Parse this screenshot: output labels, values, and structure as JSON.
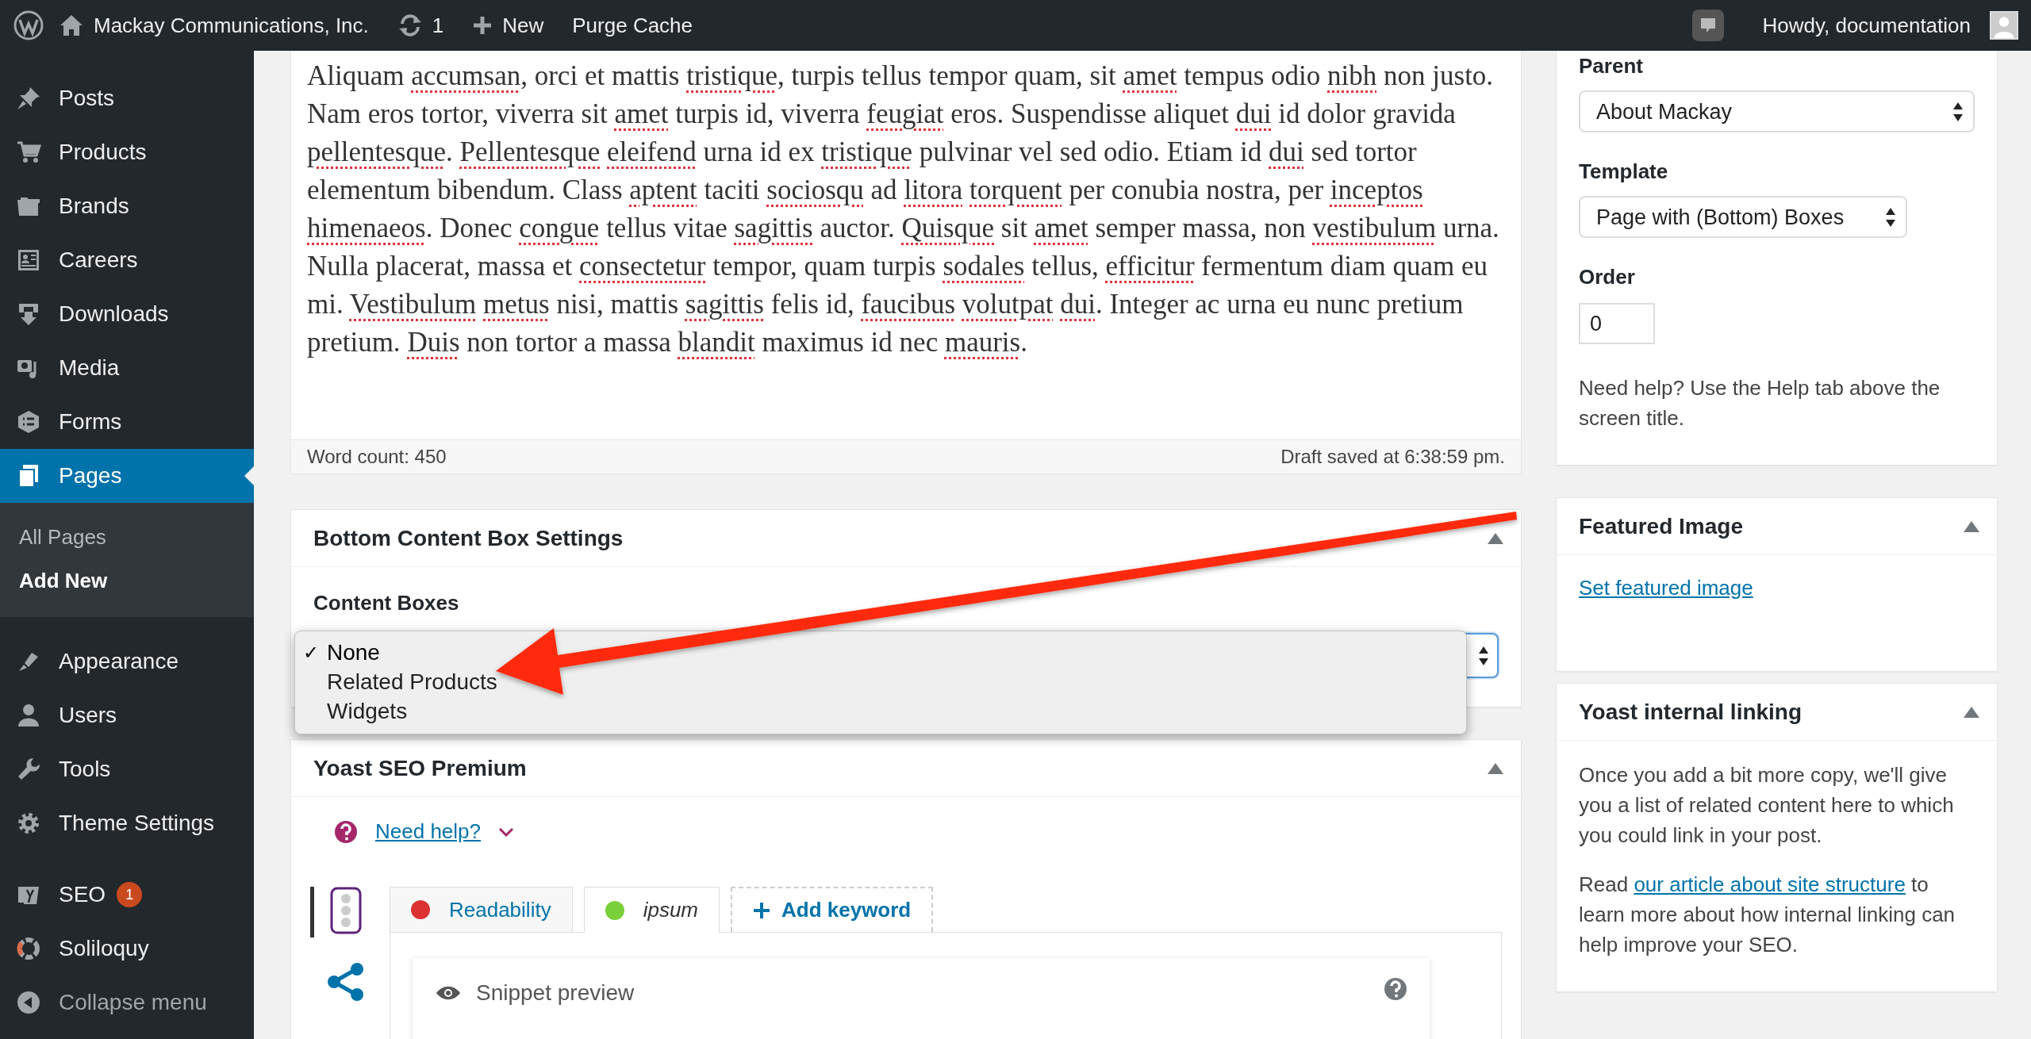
{
  "admin_bar": {
    "site_name": "Mackay Communications, Inc.",
    "updates": "1",
    "new": "New",
    "purge_cache": "Purge Cache",
    "account": "Howdy, documentation"
  },
  "menu": {
    "groups": [
      {
        "items": [
          {
            "label": "Posts",
            "selected": false
          },
          {
            "label": "Products",
            "selected": false
          },
          {
            "label": "Brands",
            "selected": false
          },
          {
            "label": "Careers",
            "selected": false
          },
          {
            "label": "Downloads",
            "selected": false
          },
          {
            "label": "Media",
            "selected": false
          },
          {
            "label": "Forms",
            "selected": false
          },
          {
            "label": "Pages",
            "selected": true,
            "children": [
              {
                "label": "All Pages",
                "selected": false
              },
              {
                "label": "Add New",
                "selected": true
              }
            ]
          },
          {
            "label": "Appearance",
            "selected": false
          },
          {
            "label": "Users",
            "selected": false
          },
          {
            "label": "Tools",
            "selected": false
          },
          {
            "label": "Theme Settings",
            "selected": false
          }
        ]
      },
      {
        "items": [
          {
            "label": "SEO",
            "selected": false,
            "badge": "1"
          },
          {
            "label": "Soliloquy",
            "selected": false
          }
        ]
      }
    ],
    "collapse": "Collapse menu"
  },
  "editor": {
    "segments": [
      {
        "text": "Aliquam ",
        "misspelled": false
      },
      {
        "text": "accumsan",
        "misspelled": true
      },
      {
        "text": ", orci et mattis ",
        "misspelled": false
      },
      {
        "text": "tristique",
        "misspelled": true
      },
      {
        "text": ", turpis tellus tempor quam, sit ",
        "misspelled": false
      },
      {
        "text": "amet",
        "misspelled": true
      },
      {
        "text": " tempus odio ",
        "misspelled": false
      },
      {
        "text": "nibh",
        "misspelled": true
      },
      {
        "text": " non justo. Nam eros tortor, viverra sit ",
        "misspelled": false
      },
      {
        "text": "amet",
        "misspelled": true
      },
      {
        "text": " turpis id, viverra ",
        "misspelled": false
      },
      {
        "text": "feugiat",
        "misspelled": true
      },
      {
        "text": " eros. Suspendisse aliquet ",
        "misspelled": false
      },
      {
        "text": "dui",
        "misspelled": true
      },
      {
        "text": " id dolor gravida ",
        "misspelled": false
      },
      {
        "text": "pellentesque",
        "misspelled": true
      },
      {
        "text": ". ",
        "misspelled": false
      },
      {
        "text": "Pellentesque ",
        "misspelled": true
      },
      {
        "text": "eleifend",
        "misspelled": true
      },
      {
        "text": " urna id ex ",
        "misspelled": false
      },
      {
        "text": "tristique",
        "misspelled": true
      },
      {
        "text": " pulvinar vel sed odio. Etiam id ",
        "misspelled": false
      },
      {
        "text": "dui",
        "misspelled": true
      },
      {
        "text": " sed tortor elementum bibendum. Class ",
        "misspelled": false
      },
      {
        "text": "aptent",
        "misspelled": true
      },
      {
        "text": " taciti ",
        "misspelled": false
      },
      {
        "text": "sociosqu",
        "misspelled": true
      },
      {
        "text": " ad ",
        "misspelled": false
      },
      {
        "text": "litora ",
        "misspelled": true
      },
      {
        "text": "torquent",
        "misspelled": true
      },
      {
        "text": " per conubia nostra, per ",
        "misspelled": false
      },
      {
        "text": "inceptos ",
        "misspelled": true
      },
      {
        "text": "himenaeos",
        "misspelled": true
      },
      {
        "text": ". Donec ",
        "misspelled": false
      },
      {
        "text": "congue",
        "misspelled": true
      },
      {
        "text": " tellus vitae ",
        "misspelled": false
      },
      {
        "text": "sagittis",
        "misspelled": true
      },
      {
        "text": " auctor. ",
        "misspelled": false
      },
      {
        "text": "Quisque",
        "misspelled": true
      },
      {
        "text": " sit ",
        "misspelled": false
      },
      {
        "text": "amet",
        "misspelled": true
      },
      {
        "text": " semper massa, non ",
        "misspelled": false
      },
      {
        "text": "vestibulum",
        "misspelled": true
      },
      {
        "text": " urna. Nulla placerat, massa et ",
        "misspelled": false
      },
      {
        "text": "consectetur",
        "misspelled": true
      },
      {
        "text": " tempor, quam turpis ",
        "misspelled": false
      },
      {
        "text": "sodales",
        "misspelled": true
      },
      {
        "text": " tellus, ",
        "misspelled": false
      },
      {
        "text": "efficitur",
        "misspelled": true
      },
      {
        "text": " fermentum diam quam eu mi. ",
        "misspelled": false
      },
      {
        "text": "Vestibulum ",
        "misspelled": true
      },
      {
        "text": "metus",
        "misspelled": true
      },
      {
        "text": " nisi, mattis ",
        "misspelled": false
      },
      {
        "text": "sagittis",
        "misspelled": true
      },
      {
        "text": " felis id, ",
        "misspelled": false
      },
      {
        "text": "faucibus ",
        "misspelled": true
      },
      {
        "text": "volutpat ",
        "misspelled": true
      },
      {
        "text": "dui",
        "misspelled": true
      },
      {
        "text": ". Integer ac urna eu nunc pretium pretium. ",
        "misspelled": false
      },
      {
        "text": "Duis",
        "misspelled": true
      },
      {
        "text": " non tortor a massa ",
        "misspelled": false
      },
      {
        "text": "blandit",
        "misspelled": true
      },
      {
        "text": " maximus id nec ",
        "misspelled": false
      },
      {
        "text": "mauris",
        "misspelled": true
      },
      {
        "text": ".",
        "misspelled": false
      }
    ],
    "word_count": "Word count: 450",
    "draft_status": "Draft saved at 6:38:59 pm."
  },
  "content_box_settings": {
    "title": "Bottom Content Box Settings",
    "label": "Content Boxes",
    "options": [
      {
        "label": "None",
        "selected": true,
        "mark": "✓"
      },
      {
        "label": "Related Products",
        "selected": false
      },
      {
        "label": "Widgets",
        "selected": false
      }
    ]
  },
  "yoast": {
    "title": "Yoast SEO Premium",
    "help_link": "Need help?",
    "tabs": [
      {
        "label": "Readability",
        "color": "#dc3232",
        "selected": false
      },
      {
        "label": "ipsum",
        "color": "#7ad03a",
        "selected": true
      }
    ],
    "add_keyword": "Add keyword",
    "snippet_title": "Snippet preview"
  },
  "page_attributes": {
    "parent_label": "Parent",
    "parent": "About Mackay",
    "template_label": "Template",
    "template": "Page with (Bottom) Boxes",
    "order_label": "Order",
    "order": "0",
    "help": "Need help? Use the Help tab above the screen title."
  },
  "featured_image": {
    "title": "Featured Image",
    "link": "Set featured image"
  },
  "internal_linking": {
    "title": "Yoast internal linking",
    "text": "Once you add a bit more copy, we'll give you a list of related content here to which you could link in your post.",
    "read_before": "Read ",
    "read_link": "our article about site structure",
    "read_after": " to learn more about how internal linking can help improve your SEO."
  }
}
